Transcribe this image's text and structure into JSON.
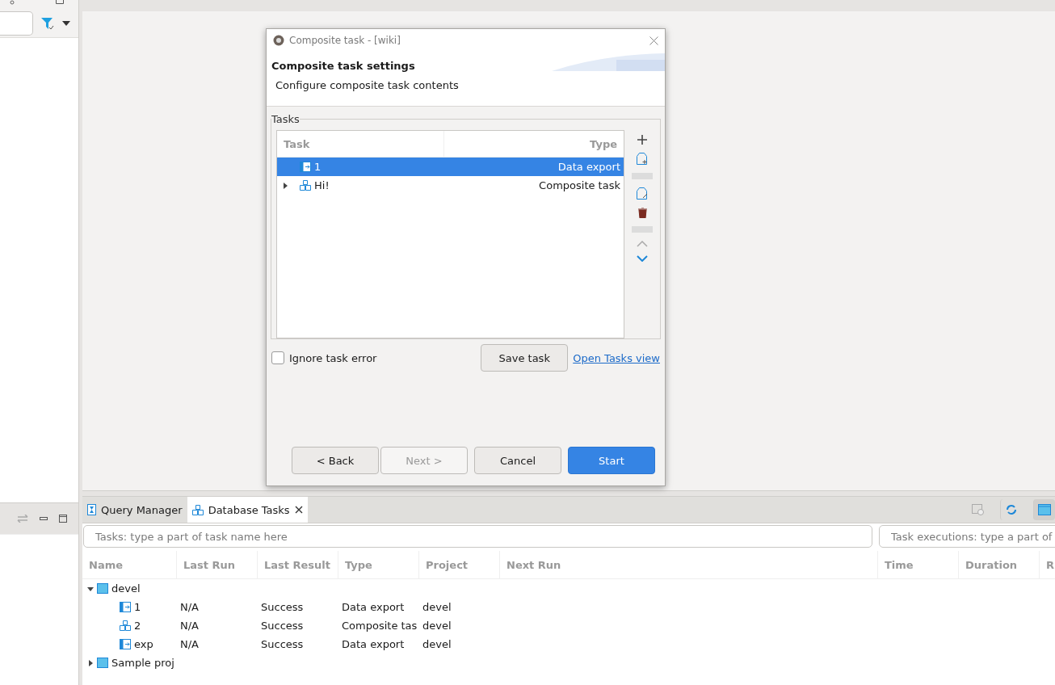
{
  "dialog": {
    "title": "Composite task - [wiki]",
    "heading": "Composite task settings",
    "description": "Configure composite task contents",
    "group_label": "Tasks",
    "columns": [
      "Task",
      "Type"
    ],
    "tasks": [
      {
        "name": "1",
        "type": "Data export",
        "kind": "export",
        "selected": true,
        "expandable": false
      },
      {
        "name": "Hi!",
        "type": "Composite task",
        "kind": "composite",
        "selected": false,
        "expandable": true
      }
    ],
    "ignore_error": {
      "label": "Ignore task error",
      "checked": false
    },
    "save_button": "Save task",
    "link": "Open Tasks view",
    "buttons": [
      {
        "label": "< Back",
        "disabled": false,
        "primary": false
      },
      {
        "label": "Next >",
        "disabled": true,
        "primary": false
      },
      {
        "label": "Cancel",
        "disabled": false,
        "primary": false
      },
      {
        "label": "Start",
        "disabled": false,
        "primary": true
      }
    ]
  },
  "bottom_panel": {
    "tabs": [
      {
        "label": "Query Manager",
        "kind": "query",
        "selected": false
      },
      {
        "label": "Database Tasks",
        "kind": "tasks",
        "selected": true
      }
    ],
    "task_search": {
      "placeholder": "Tasks: type a part of task name here"
    },
    "execution_search": {
      "placeholder": "Task executions: type a part of"
    },
    "task_columns": [
      "Name",
      "Last Run",
      "Last Result",
      "Type",
      "Project",
      "Next Run"
    ],
    "tasks": [
      {
        "name": "devel",
        "kind": "project",
        "expanded": true,
        "children": [
          {
            "name": "1",
            "kind": "export",
            "last_run": "N/A",
            "last_result": "Success",
            "type": "Data export",
            "project": "devel"
          },
          {
            "name": "2",
            "kind": "composite",
            "last_run": "N/A",
            "last_result": "Success",
            "type": "Composite tas",
            "project": "devel"
          },
          {
            "name": "exp",
            "kind": "export",
            "last_run": "N/A",
            "last_result": "Success",
            "type": "Data export",
            "project": "devel"
          }
        ]
      },
      {
        "name": "Sample proj",
        "kind": "project",
        "expanded": false
      }
    ],
    "execution_columns": [
      "Time",
      "Duration",
      "R"
    ]
  }
}
